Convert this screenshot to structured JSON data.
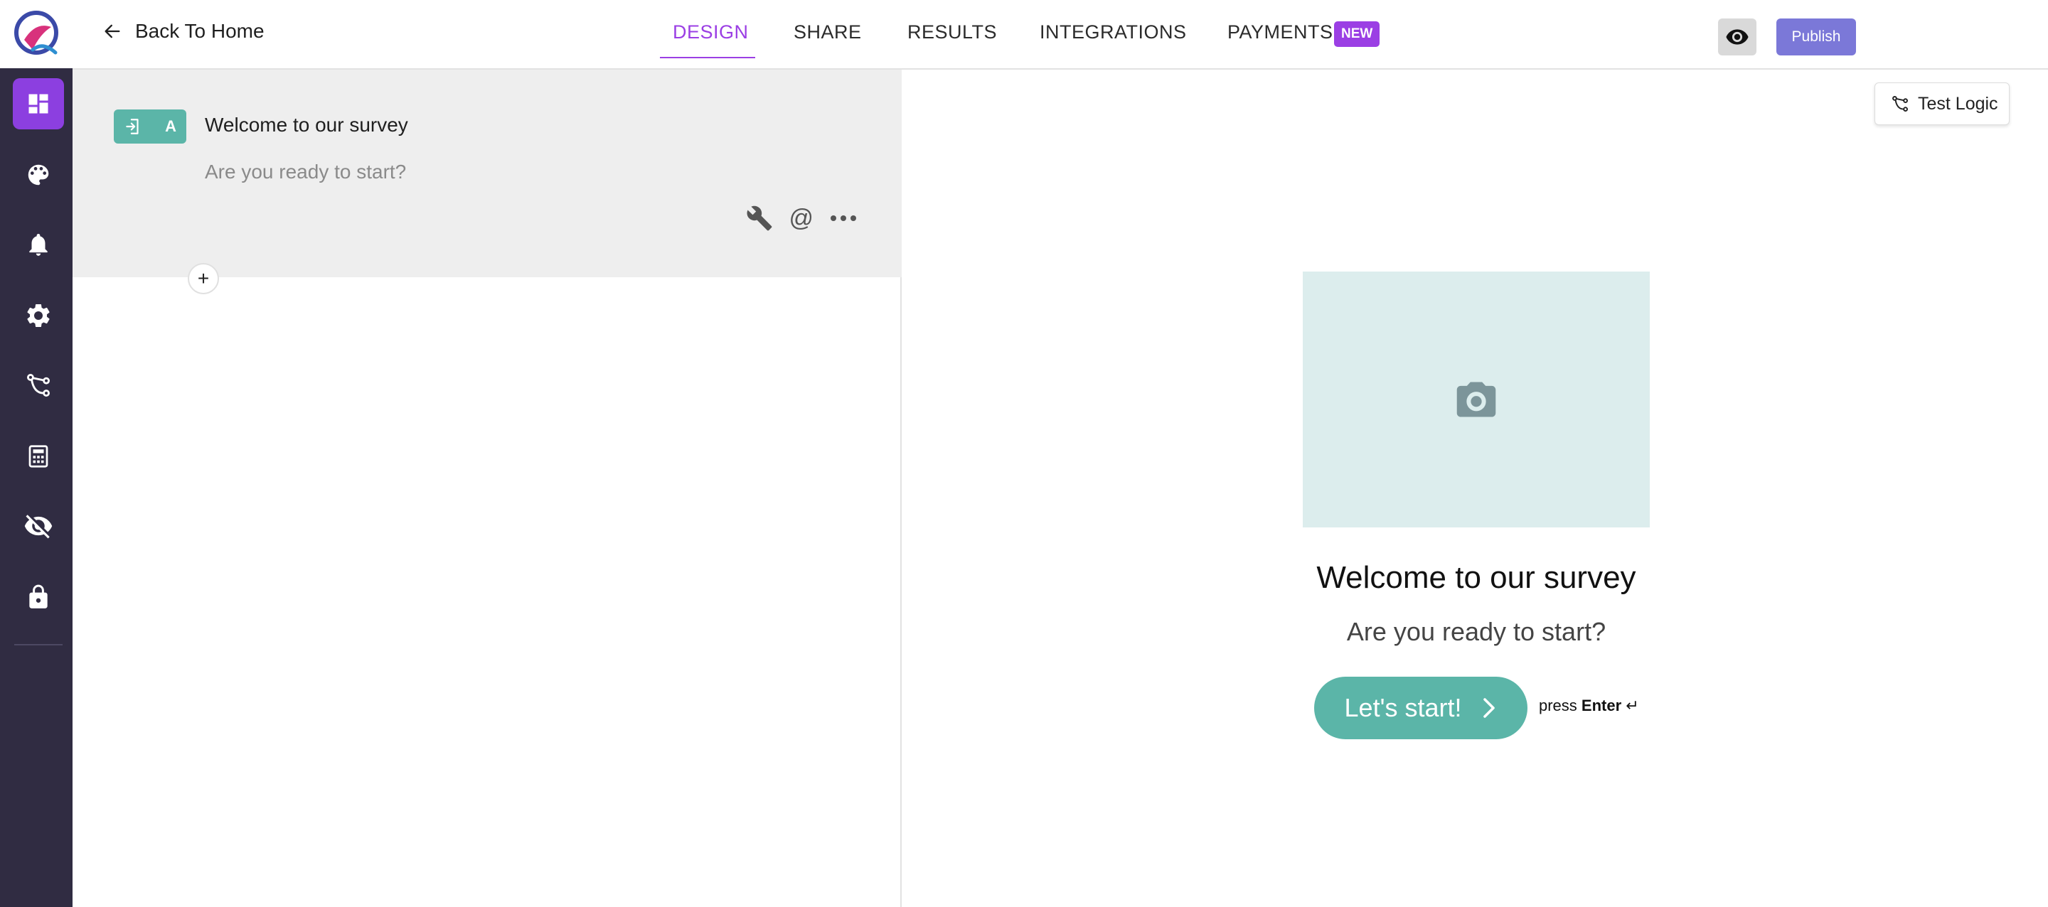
{
  "header": {
    "back_label": "Back To Home",
    "tabs": [
      {
        "label": "DESIGN",
        "active": true
      },
      {
        "label": "SHARE",
        "active": false
      },
      {
        "label": "RESULTS",
        "active": false
      },
      {
        "label": "INTEGRATIONS",
        "active": false
      },
      {
        "label": "PAYMENTS",
        "active": false
      }
    ],
    "payments_badge": "NEW",
    "publish_label": "Publish",
    "accent_color": "#9b3fe4",
    "publish_color": "#7b78d8"
  },
  "sidebar": {
    "items": [
      {
        "icon": "dashboard-icon",
        "active": true
      },
      {
        "icon": "palette-icon",
        "active": false
      },
      {
        "icon": "bell-icon",
        "active": false
      },
      {
        "icon": "gear-icon",
        "active": false
      },
      {
        "icon": "logic-flow-icon",
        "active": false
      },
      {
        "icon": "calculator-icon",
        "active": false
      },
      {
        "icon": "eye-off-icon",
        "active": false
      },
      {
        "icon": "lock-icon",
        "active": false
      }
    ],
    "active_color": "#8c3fe0",
    "background_color": "#302c42"
  },
  "editor": {
    "question_chip_letter": "A",
    "question_title": "Welcome to our survey",
    "question_subtitle": "Are you ready to start?",
    "add_symbol": "+",
    "chip_color": "#5bb5a8"
  },
  "preview": {
    "test_logic_label": "Test Logic",
    "title": "Welcome to our survey",
    "subtitle": "Are you ready to start?",
    "start_button_label": "Let's start!",
    "press_hint_prefix": "press",
    "press_hint_key": "Enter",
    "press_hint_symbol": "↵",
    "button_color": "#5bb5a8",
    "image_placeholder_color": "#dceded"
  }
}
